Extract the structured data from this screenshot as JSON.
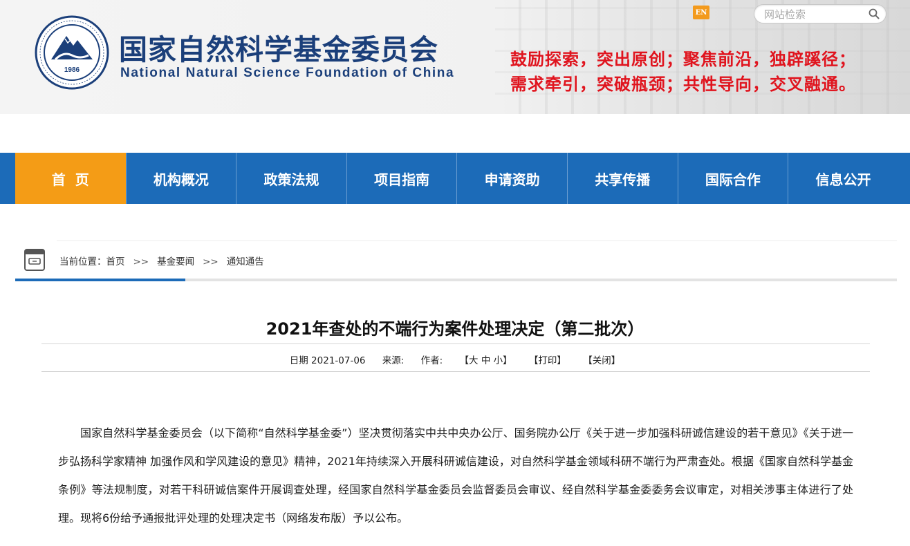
{
  "header": {
    "org_name_cn": "国家自然科学基金委员会",
    "org_name_en": "National Natural Science Foundation of China",
    "seal_year": "1986",
    "slogan_line1": "鼓励探索，突出原创；聚焦前沿，独辟蹊径；",
    "slogan_line2": "需求牵引，突破瓶颈；共性导向，交叉融通。",
    "en_label": "EN",
    "search_placeholder": "网站检索"
  },
  "nav": {
    "items": [
      {
        "label": "首页"
      },
      {
        "label": "机构概况"
      },
      {
        "label": "政策法规"
      },
      {
        "label": "项目指南"
      },
      {
        "label": "申请资助"
      },
      {
        "label": "共享传播"
      },
      {
        "label": "国际合作"
      },
      {
        "label": "信息公开"
      }
    ],
    "active_index": 0
  },
  "breadcrumb": {
    "prefix": "当前位置：",
    "items": [
      "首页",
      "基金要闻",
      "通知通告"
    ],
    "separator": ">>"
  },
  "article": {
    "title": "2021年查处的不端行为案件处理决定（第二批次）",
    "date": "日期 2021-07-06",
    "source": "来源:",
    "author": "作者:",
    "font_size_tool": "【大 中 小】",
    "print_tool": "【打印】",
    "close_tool": "【关闭】",
    "body": "国家自然科学基金委员会（以下简称“自然科学基金委”）坚决贯彻落实中共中央办公厅、国务院办公厅《关于进一步加强科研诚信建设的若干意见》《关于进一步弘扬科学家精神 加强作风和学风建设的意见》精神，2021年持续深入开展科研诚信建设，对自然科学基金领域科研不端行为严肃查处。根据《国家自然科学基金条例》等法规制度，对若干科研诚信案件开展调查处理，经国家自然科学基金委员会监督委员会审议、经自然科学基金委委务会议审定，对相关涉事主体进行了处理。现将6份给予通报批评处理的处理决定书（网络发布版）予以公布。"
  },
  "colors": {
    "brand_blue": "#1c6bb8",
    "active_orange": "#f49c16",
    "slogan_red": "#e0141e",
    "logo_navy": "#1b3f7a"
  }
}
